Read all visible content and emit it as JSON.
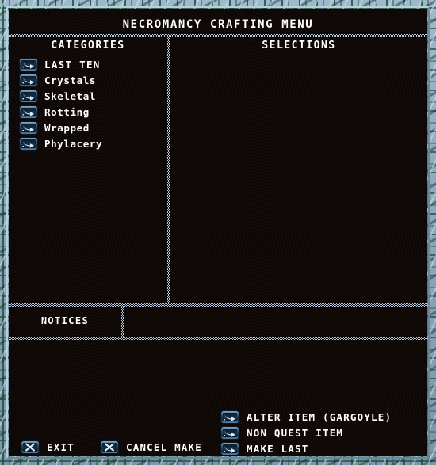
{
  "window": {
    "title": "NECROMANCY CRAFTING MENU"
  },
  "columns": {
    "categories_header": "CATEGORIES",
    "selections_header": "SELECTIONS"
  },
  "categories": {
    "items": [
      {
        "label": "LAST TEN",
        "icon": "arrow-right-icon"
      },
      {
        "label": "Crystals",
        "icon": "arrow-right-icon"
      },
      {
        "label": "Skeletal",
        "icon": "arrow-right-icon"
      },
      {
        "label": "Rotting",
        "icon": "arrow-right-icon"
      },
      {
        "label": "Wrapped",
        "icon": "arrow-right-icon"
      },
      {
        "label": "Phylacery",
        "icon": "arrow-right-icon"
      }
    ]
  },
  "selections": {
    "items": []
  },
  "notices": {
    "label": "NOTICES",
    "text": ""
  },
  "actions": {
    "items": [
      {
        "label": "ALTER ITEM (GARGOYLE)",
        "icon": "arrow-right-icon"
      },
      {
        "label": "NON QUEST ITEM",
        "icon": "arrow-right-icon"
      },
      {
        "label": "MAKE LAST",
        "icon": "arrow-right-icon"
      }
    ]
  },
  "buttons": {
    "exit": {
      "label": "EXIT",
      "icon": "x-icon"
    },
    "cancel_make": {
      "label": "CANCEL MAKE",
      "icon": "x-icon"
    }
  },
  "colors": {
    "frame_blue": "#9fb8cc",
    "frame_vine_green": "#1a4e38",
    "panel_background": "#0d0806",
    "divider_blue": "#b7cbe6",
    "text_white": "#ffffff",
    "icon_blue": "#2c4e6e"
  }
}
